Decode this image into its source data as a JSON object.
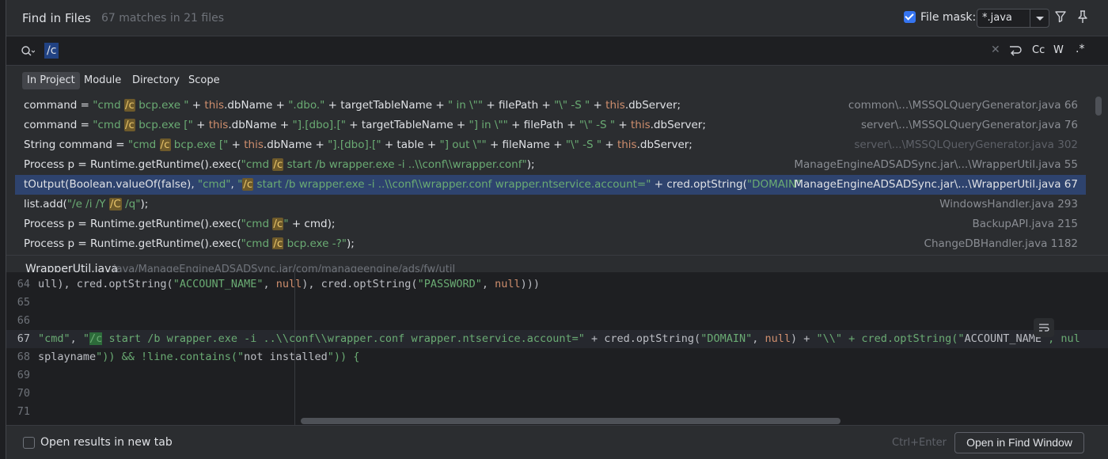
{
  "header": {
    "title": "Find in Files",
    "match_count": "67 matches in 21 files",
    "file_mask_label": "File mask:",
    "file_mask_checked": true,
    "file_mask_value": "*.java",
    "icons": [
      "filter-icon",
      "pin-icon"
    ]
  },
  "search": {
    "query": "/c",
    "icons": [
      "search-icon",
      "clear-icon",
      "wrap-icon"
    ],
    "options": {
      "case": "Cc",
      "word": "W",
      "regex": ".*"
    }
  },
  "scopes": [
    {
      "label": "In Project",
      "active": true
    },
    {
      "label": "Module",
      "active": false
    },
    {
      "label": "Directory",
      "active": false
    },
    {
      "label": "Scope",
      "active": false
    }
  ],
  "results": [
    {
      "code": "command = \"cmd /c bcp.exe \" + this.dbName + \".dbo.\" + targetTableName + \" in \\\"\" + filePath + \"\\\" -S \" + this.dbServer;",
      "file": "common\\...\\MSSQLQueryGenerator.java 66"
    },
    {
      "code": "command = \"cmd /c bcp.exe [\" + this.dbName + \"].[dbo].[\" + targetTableName + \"] in \\\"\" + filePath + \"\\\" -S \" + this.dbServer;",
      "file": "server\\...\\MSSQLQueryGenerator.java 76"
    },
    {
      "code": "String command = \"cmd /c bcp.exe [\" + this.dbName + \"].[dbo].[\" + table + \"] out \\\"\" + fileName + \"\\\" -S \" + this.dbServer;",
      "file": "server\\...\\MSSQLQueryGenerator.java 302"
    },
    {
      "code": "Process p = Runtime.getRuntime().exec(\"cmd /c start /b wrapper.exe -i ..\\\\conf\\\\wrapper.conf\");",
      "file": "ManageEngineADSADSync.jar\\...\\WrapperUtil.java 55"
    },
    {
      "code": "tOutput(Boolean.valueOf(false), \"cmd\", \"/c start /b wrapper.exe -i ..\\\\conf\\\\wrapper.conf wrapper.ntservice.account=\" + cred.optString(\"DOMAIN\"",
      "file": "ManageEngineADSADSync.jar\\...\\WrapperUtil.java 67"
    },
    {
      "code": "list.add(\"/e /i /Y /C /q\");",
      "file": "WindowsHandler.java 293"
    },
    {
      "code": "Process p = Runtime.getRuntime().exec(\"cmd /c\" + cmd);",
      "file": "BackupAPI.java 215"
    },
    {
      "code": "Process p = Runtime.getRuntime().exec(\"cmd /c bcp.exe -?\");",
      "file": "ChangeDBHandler.java 1182"
    }
  ],
  "preview": {
    "file_name": "WrapperUtil.java",
    "file_path": "java/ManageEngineADSADSync.jar/com/manageengine/ads/fw/util",
    "lines": [
      {
        "num": "64",
        "text": "ull), cred.optString(\"ACCOUNT_NAME\", null), cred.optString(\"PASSWORD\", null)))"
      },
      {
        "num": "65",
        "text": ""
      },
      {
        "num": "66",
        "text": ""
      },
      {
        "num": "67",
        "text": "\"cmd\", \"/c start /b wrapper.exe -i ..\\\\conf\\\\wrapper.conf wrapper.ntservice.account=\" + cred.optString(\"DOMAIN\", null) + \"\\\\\" + cred.optString(\"ACCOUNT_NAME\", nul"
      },
      {
        "num": "68",
        "text": "splayname\")) && !line.contains(\"not installed\")) {"
      },
      {
        "num": "69",
        "text": ""
      },
      {
        "num": "70",
        "text": ""
      },
      {
        "num": "71",
        "text": ""
      }
    ]
  },
  "footer": {
    "open_new_tab_label": "Open results in new tab",
    "open_new_tab_checked": false,
    "shortcut": "Ctrl+Enter",
    "open_button": "Open in Find Window"
  },
  "colors": {
    "selection": "#2e436e",
    "match_highlight": "#6e5a2a",
    "string": "#6aab73",
    "keyword": "#cf8e6d",
    "accent": "#3574f0"
  }
}
